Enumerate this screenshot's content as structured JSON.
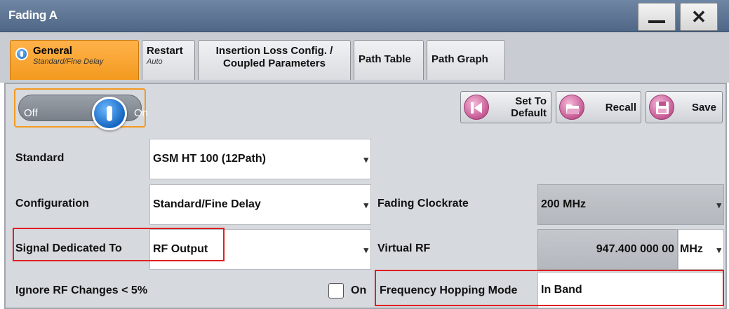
{
  "window": {
    "title": "Fading A",
    "minimize_icon": "minimize-icon",
    "close_glyph": "✕"
  },
  "tabs": [
    {
      "label": "General",
      "sub": "Standard/Fine Delay",
      "active": true
    },
    {
      "label": "Restart",
      "sub": "Auto"
    },
    {
      "label": "Insertion Loss Config. /",
      "label2": "Coupled Parameters"
    },
    {
      "label": "Path Table"
    },
    {
      "label": "Path Graph"
    }
  ],
  "toggle": {
    "off_label": "Off",
    "on_label": "On",
    "state": "On"
  },
  "buttons": {
    "set_default_line1": "Set To",
    "set_default_line2": "Default",
    "recall": "Recall",
    "save": "Save"
  },
  "form": {
    "standard_label": "Standard",
    "standard_value": "GSM HT 100 (12Path)",
    "configuration_label": "Configuration",
    "configuration_value": "Standard/Fine Delay",
    "signal_label": "Signal Dedicated To",
    "signal_value": "RF Output",
    "ignore_label": "Ignore RF Changes < 5%",
    "ignore_checkbox_label": "On",
    "ignore_checked": false,
    "clockrate_label": "Fading Clockrate",
    "clockrate_value": "200 MHz",
    "virtual_rf_label": "Virtual RF",
    "virtual_rf_value": "947.400 000 00",
    "virtual_rf_unit": "MHz",
    "hopping_label": "Frequency Hopping Mode",
    "hopping_value": "In Band"
  },
  "colors": {
    "accent": "#f39a1f",
    "highlight": "#e02020",
    "titlebar": "#5b7292"
  }
}
